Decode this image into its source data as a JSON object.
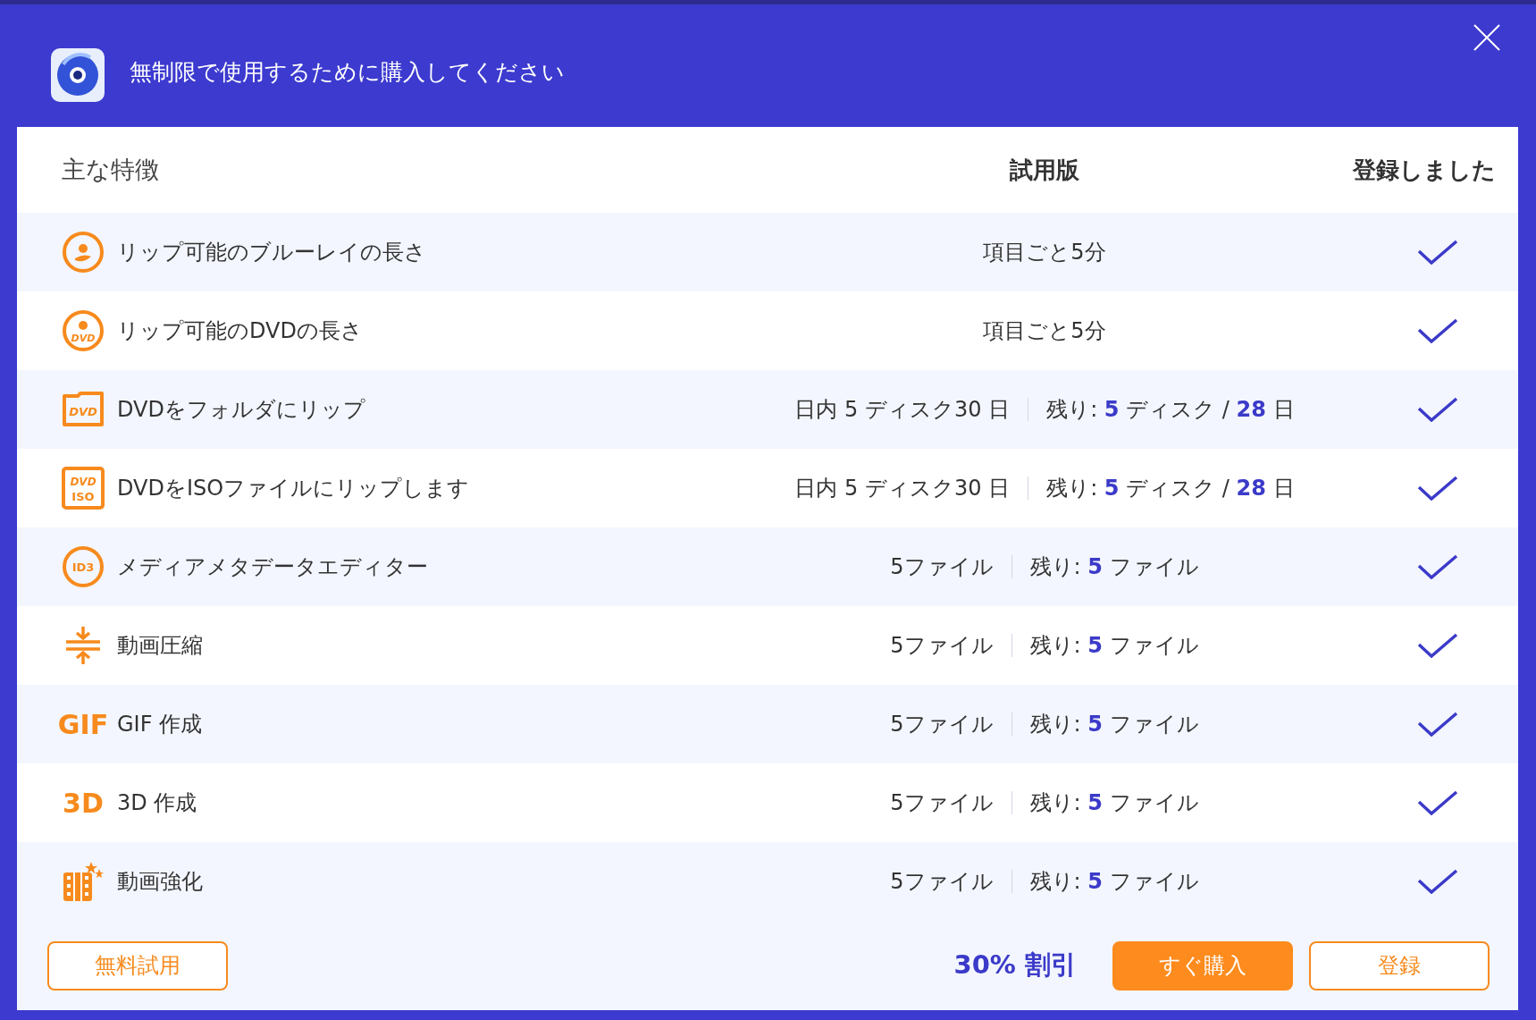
{
  "window": {
    "title": "無制限で使用するために購入してください"
  },
  "table": {
    "columns": [
      "主な特徴",
      "試用版",
      "登録しました"
    ],
    "rows": [
      {
        "feature": "リップ可能のブルーレイの長さ",
        "trial": "項目ごと5分",
        "registered": true
      },
      {
        "feature": "リップ可能のDVDの長さ",
        "icon_text": [
          "DVD"
        ],
        "trial": "項目ごと5分",
        "registered": true
      },
      {
        "feature": "DVDをフォルダにリップ",
        "icon_text": [
          "DVD"
        ],
        "trial": "日内 5 ディスク30 日",
        "remaining": "残り: **5** ディスク / **28** 日",
        "registered": true
      },
      {
        "feature": "DVDをISOファイルにリップします",
        "icon_text": [
          "DVD",
          "ISO"
        ],
        "trial": "日内 5 ディスク30 日",
        "remaining": "残り: **5** ディスク / **28** 日",
        "registered": true
      },
      {
        "feature": "メディアメタデータエディター",
        "icon_text": [
          "ID3"
        ],
        "trial": "5ファイル",
        "remaining": "残り: **5** ファイル",
        "registered": true
      },
      {
        "feature": "動画圧縮",
        "trial": "5ファイル",
        "remaining": "残り: **5** ファイル",
        "registered": true
      },
      {
        "feature": "GIF 作成",
        "icon_text": [
          "GIF"
        ],
        "trial": "5ファイル",
        "remaining": "残り: **5** ファイル",
        "registered": true
      },
      {
        "feature": "3D 作成",
        "icon_text": [
          "3D"
        ],
        "trial": "5ファイル",
        "remaining": "残り: **5** ファイル",
        "registered": true
      },
      {
        "feature": "動画強化",
        "trial": "5ファイル",
        "remaining": "残り: **5** ファイル",
        "registered": true
      }
    ]
  },
  "footer": {
    "left_button": {
      "label": "無料試用",
      "kind": "outline"
    },
    "discount": "30% 割引",
    "buttons": [
      {
        "label": "すぐ購入",
        "kind": "primary"
      },
      {
        "label": "登録",
        "kind": "outline"
      }
    ]
  }
}
